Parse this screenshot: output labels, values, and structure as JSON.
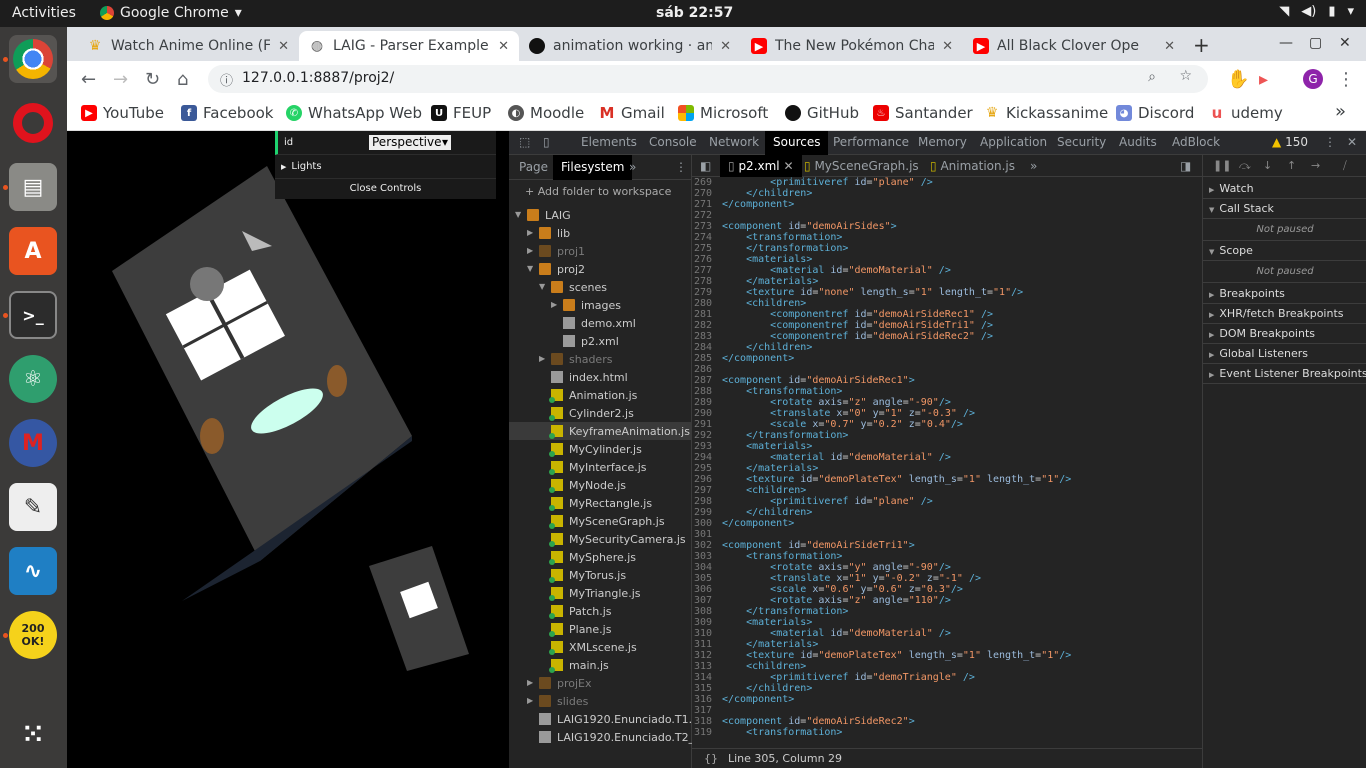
{
  "os": {
    "activities": "Activities",
    "app_name": "Google Chrome",
    "clock": "sáb 22:57"
  },
  "tabs": [
    {
      "title": "Watch Anime Online (F",
      "icon": "crown-icon"
    },
    {
      "title": "LAIG - Parser Example",
      "icon": "globe-icon"
    },
    {
      "title": "animation working · an",
      "icon": "github-icon"
    },
    {
      "title": "The New Pokémon Cha",
      "icon": "youtube-icon"
    },
    {
      "title": "All Black Clover Ope",
      "icon": "youtube-icon"
    }
  ],
  "url": "127.0.0.1:8887/proj2/",
  "bookmarks": [
    "YouTube",
    "Facebook",
    "WhatsApp Web",
    "FEUP",
    "Moodle",
    "Gmail",
    "Microsoft",
    "GitHub",
    "Santander",
    "Kickassanime",
    "Discord",
    "udemy"
  ],
  "gui": {
    "id_label": "id",
    "camera": "Perspective",
    "lights": "Lights",
    "close": "Close Controls"
  },
  "devtools": {
    "tabs": [
      "Elements",
      "Console",
      "Network",
      "Sources",
      "Performance",
      "Memory",
      "Application",
      "Security",
      "Audits",
      "AdBlock"
    ],
    "warnings": "150",
    "nav_tabs": [
      "Page",
      "Filesystem"
    ],
    "add_folder": "Add folder to workspace",
    "tree": [
      {
        "name": "LAIG",
        "d": 0,
        "t": "folder",
        "a": "▼"
      },
      {
        "name": "lib",
        "d": 1,
        "t": "folder",
        "a": "▶"
      },
      {
        "name": "proj1",
        "d": 1,
        "t": "folder-dim",
        "a": "▶"
      },
      {
        "name": "proj2",
        "d": 1,
        "t": "folder",
        "a": "▼"
      },
      {
        "name": "scenes",
        "d": 2,
        "t": "folder",
        "a": "▼"
      },
      {
        "name": "images",
        "d": 3,
        "t": "folder",
        "a": "▶"
      },
      {
        "name": "demo.xml",
        "d": 3,
        "t": "file",
        "a": ""
      },
      {
        "name": "p2.xml",
        "d": 3,
        "t": "file",
        "a": ""
      },
      {
        "name": "shaders",
        "d": 2,
        "t": "folder-dim",
        "a": "▶"
      },
      {
        "name": "index.html",
        "d": 2,
        "t": "html",
        "a": ""
      },
      {
        "name": "Animation.js",
        "d": 2,
        "t": "js",
        "a": ""
      },
      {
        "name": "Cylinder2.js",
        "d": 2,
        "t": "js",
        "a": ""
      },
      {
        "name": "KeyframeAnimation.js",
        "d": 2,
        "t": "js",
        "a": ""
      },
      {
        "name": "MyCylinder.js",
        "d": 2,
        "t": "js",
        "a": ""
      },
      {
        "name": "MyInterface.js",
        "d": 2,
        "t": "js",
        "a": ""
      },
      {
        "name": "MyNode.js",
        "d": 2,
        "t": "js",
        "a": ""
      },
      {
        "name": "MyRectangle.js",
        "d": 2,
        "t": "js",
        "a": ""
      },
      {
        "name": "MySceneGraph.js",
        "d": 2,
        "t": "js",
        "a": ""
      },
      {
        "name": "MySecurityCamera.js",
        "d": 2,
        "t": "js",
        "a": ""
      },
      {
        "name": "MySphere.js",
        "d": 2,
        "t": "js",
        "a": ""
      },
      {
        "name": "MyTorus.js",
        "d": 2,
        "t": "js",
        "a": ""
      },
      {
        "name": "MyTriangle.js",
        "d": 2,
        "t": "js",
        "a": ""
      },
      {
        "name": "Patch.js",
        "d": 2,
        "t": "js",
        "a": ""
      },
      {
        "name": "Plane.js",
        "d": 2,
        "t": "js",
        "a": ""
      },
      {
        "name": "XMLscene.js",
        "d": 2,
        "t": "js",
        "a": ""
      },
      {
        "name": "main.js",
        "d": 2,
        "t": "js",
        "a": ""
      },
      {
        "name": "projEx",
        "d": 1,
        "t": "folder-dim",
        "a": "▶"
      },
      {
        "name": "slides",
        "d": 1,
        "t": "folder-dim",
        "a": "▶"
      },
      {
        "name": "LAIG1920.Enunciado.T1.pdf",
        "d": 1,
        "t": "file",
        "a": ""
      },
      {
        "name": "LAIG1920.Enunciado.T2_V1.p",
        "d": 1,
        "t": "file",
        "a": ""
      }
    ],
    "selected_file": "KeyframeAnimation.js",
    "editor_tabs": [
      "p2.xml",
      "MySceneGraph.js",
      "Animation.js"
    ],
    "status": "Line 305, Column 29",
    "debug_sections": [
      "Watch",
      "Call Stack",
      "Scope",
      "Breakpoints",
      "XHR/fetch Breakpoints",
      "DOM Breakpoints",
      "Global Listeners",
      "Event Listener Breakpoints"
    ],
    "not_paused": "Not paused",
    "code_start": 269,
    "code": [
      "        <primitiveref id=\"plane\" />",
      "    </children>",
      "</component>",
      "",
      "<component id=\"demoAirSides\">",
      "    <transformation>",
      "    </transformation>",
      "    <materials>",
      "        <material id=\"demoMaterial\" />",
      "    </materials>",
      "    <texture id=\"none\" length_s=\"1\" length_t=\"1\"/>",
      "    <children>",
      "        <componentref id=\"demoAirSideRec1\" />",
      "        <componentref id=\"demoAirSideTri1\" />",
      "        <componentref id=\"demoAirSideRec2\" />",
      "    </children>",
      "</component>",
      "",
      "<component id=\"demoAirSideRec1\">",
      "    <transformation>",
      "        <rotate axis=\"z\" angle=\"-90\"/>",
      "        <translate x=\"0\" y=\"1\" z=\"-0.3\" />",
      "        <scale x=\"0.7\" y=\"0.2\" z=\"0.4\"/>",
      "    </transformation>",
      "    <materials>",
      "        <material id=\"demoMaterial\" />",
      "    </materials>",
      "    <texture id=\"demoPlateTex\" length_s=\"1\" length_t=\"1\"/>",
      "    <children>",
      "        <primitiveref id=\"plane\" />",
      "    </children>",
      "</component>",
      "",
      "<component id=\"demoAirSideTri1\">",
      "    <transformation>",
      "        <rotate axis=\"y\" angle=\"-90\"/>",
      "        <translate x=\"1\" y=\"-0.2\" z=\"-1\" />",
      "        <scale x=\"0.6\" y=\"0.6\" z=\"0.3\"/>",
      "        <rotate axis=\"z\" angle=\"110\"/>",
      "    </transformation>",
      "    <materials>",
      "        <material id=\"demoMaterial\" />",
      "    </materials>",
      "    <texture id=\"demoPlateTex\" length_s=\"1\" length_t=\"1\"/>",
      "    <children>",
      "        <primitiveref id=\"demoTriangle\" />",
      "    </children>",
      "</component>",
      "",
      "<component id=\"demoAirSideRec2\">",
      "    <transformation>"
    ]
  }
}
